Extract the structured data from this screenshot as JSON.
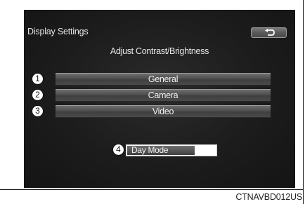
{
  "screen": {
    "title": "Display Settings",
    "subtitle": "Adjust Contrast/Brightness",
    "back_icon": "back-arrow-icon"
  },
  "menu": [
    {
      "callout": "1",
      "label": "General"
    },
    {
      "callout": "2",
      "label": "Camera"
    },
    {
      "callout": "3",
      "label": "Video"
    }
  ],
  "day_mode": {
    "callout": "4",
    "label": "Day Mode"
  },
  "caption": "CTNAVBD012US",
  "colors": {
    "screen_bg": "#1c1c1c",
    "button_face": "#4e4e4e",
    "text": "#e6e6e6"
  }
}
